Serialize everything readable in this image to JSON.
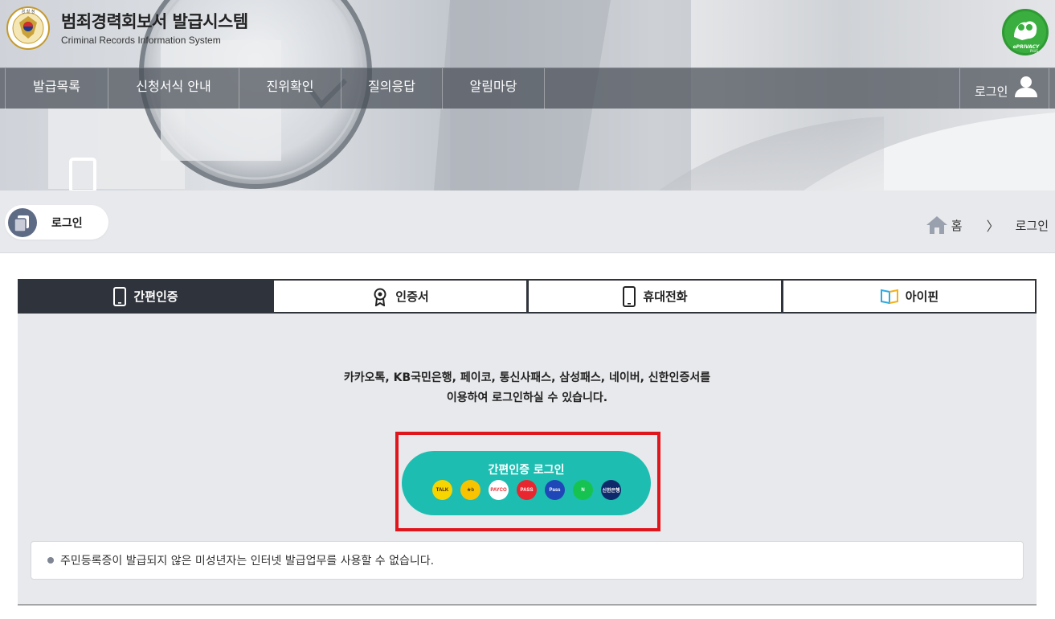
{
  "header": {
    "title": "범죄경력회보서 발급시스템",
    "subtitle": "Criminal Records Information System",
    "emblem_text": "경 찰 청",
    "emblem_ring": "KOREAN NATIONAL POLICE AGENCY",
    "eprivacy_label": "ePRIVACY",
    "eprivacy_plus": "PLUS"
  },
  "nav": {
    "items": [
      "발급목록",
      "신청서식 안내",
      "진위확인",
      "질의응답",
      "알림마당"
    ],
    "login_label": "로그인"
  },
  "location": {
    "page_title": "로그인",
    "breadcrumb_home": "홈",
    "breadcrumb_sep": "〉",
    "breadcrumb_current": "로그인"
  },
  "tabs": [
    {
      "label": "간편인증",
      "icon": "mobile-icon",
      "active": true
    },
    {
      "label": "인증서",
      "icon": "certificate-icon",
      "active": false
    },
    {
      "label": "휴대전화",
      "icon": "phone-icon",
      "active": false
    },
    {
      "label": "아이핀",
      "icon": "ipin-icon",
      "active": false
    }
  ],
  "panel": {
    "description_line1": "카카오톡, KB국민은행, 페이코, 통신사패스, 삼성패스, 네이버, 신한인증서를",
    "description_line2": "이용하여 로그인하실 수 있습니다.",
    "simple_login_label": "간편인증 로그인",
    "providers": [
      {
        "name": "kakao-talk",
        "text": "TALK",
        "bg": "#f7d500",
        "fg": "#3b1e1e"
      },
      {
        "name": "kb-bank",
        "text": "★b",
        "bg": "#f8c300",
        "fg": "#4a3b1c"
      },
      {
        "name": "payco",
        "text": "PAYCO",
        "bg": "#ffffff",
        "fg": "#e3252c"
      },
      {
        "name": "pass",
        "text": "PASS",
        "bg": "#e8262f",
        "fg": "#ffffff"
      },
      {
        "name": "samsung-pass",
        "text": "Pass",
        "bg": "#1f47b8",
        "fg": "#ffffff"
      },
      {
        "name": "naver",
        "text": "N",
        "bg": "#17c350",
        "fg": "#ffffff"
      },
      {
        "name": "shinhan",
        "text": "신한은행",
        "bg": "#0f2a6b",
        "fg": "#ffffff"
      }
    ],
    "notice": "주민등록증이 발급되지 않은 미성년자는 인터넷 발급업무를 사용할 수 없습니다."
  },
  "colors": {
    "tab_active": "#2f333b",
    "simple_login_bg": "#1ebdb1",
    "highlight_border": "#e0161d",
    "panel_bg": "#e8e9ec"
  }
}
